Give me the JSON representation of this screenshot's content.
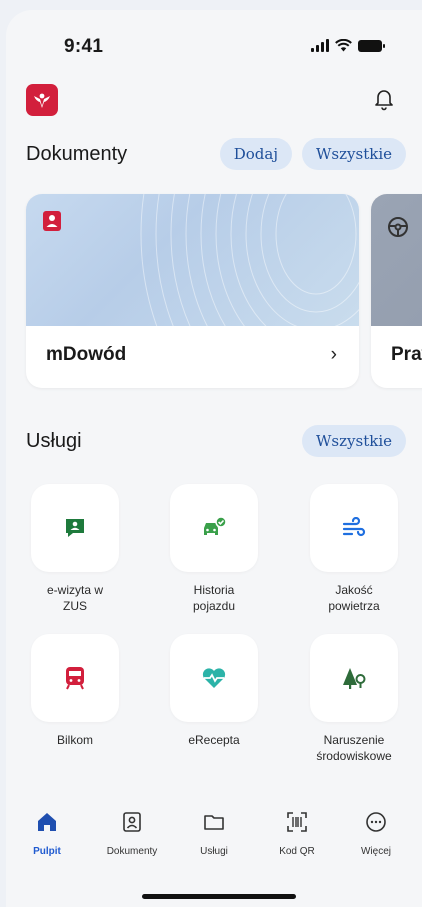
{
  "status_bar": {
    "time": "9:41"
  },
  "documents": {
    "title": "Dokumenty",
    "add_label": "Dodaj",
    "all_label": "Wszystkie",
    "cards": [
      {
        "label": "mDowód",
        "icon": "id-card-icon",
        "accent": "#d21f3c"
      },
      {
        "label": "Prawo jazdy",
        "visible_label": "Praw",
        "icon": "steering-wheel-icon"
      }
    ]
  },
  "services": {
    "title": "Usługi",
    "all_label": "Wszystkie",
    "items": [
      {
        "label": "e-wizyta w\nZUS",
        "icon": "chat-person-icon",
        "color": "#1e7a3c"
      },
      {
        "label": "Historia\npojazdu",
        "icon": "car-check-icon",
        "color": "#3aa04a"
      },
      {
        "label": "Jakość\npowietrza",
        "icon": "wind-icon",
        "color": "#1f6fe0"
      },
      {
        "label": "Bilkom",
        "icon": "train-icon",
        "color": "#d21f3c"
      },
      {
        "label": "eRecepta",
        "icon": "heart-pulse-icon",
        "color": "#2bb3a8"
      },
      {
        "label": "Naruszenie\nśrodowiskowe",
        "icon": "tree-pin-icon",
        "color": "#2e6b3a"
      }
    ]
  },
  "nav": {
    "items": [
      {
        "label": "Pulpit",
        "icon": "home-icon",
        "active": true
      },
      {
        "label": "Dokumenty",
        "icon": "id-badge-icon"
      },
      {
        "label": "Usługi",
        "icon": "folder-icon"
      },
      {
        "label": "Kod QR",
        "icon": "qr-scan-icon"
      },
      {
        "label": "Więcej",
        "icon": "more-icon"
      }
    ]
  }
}
